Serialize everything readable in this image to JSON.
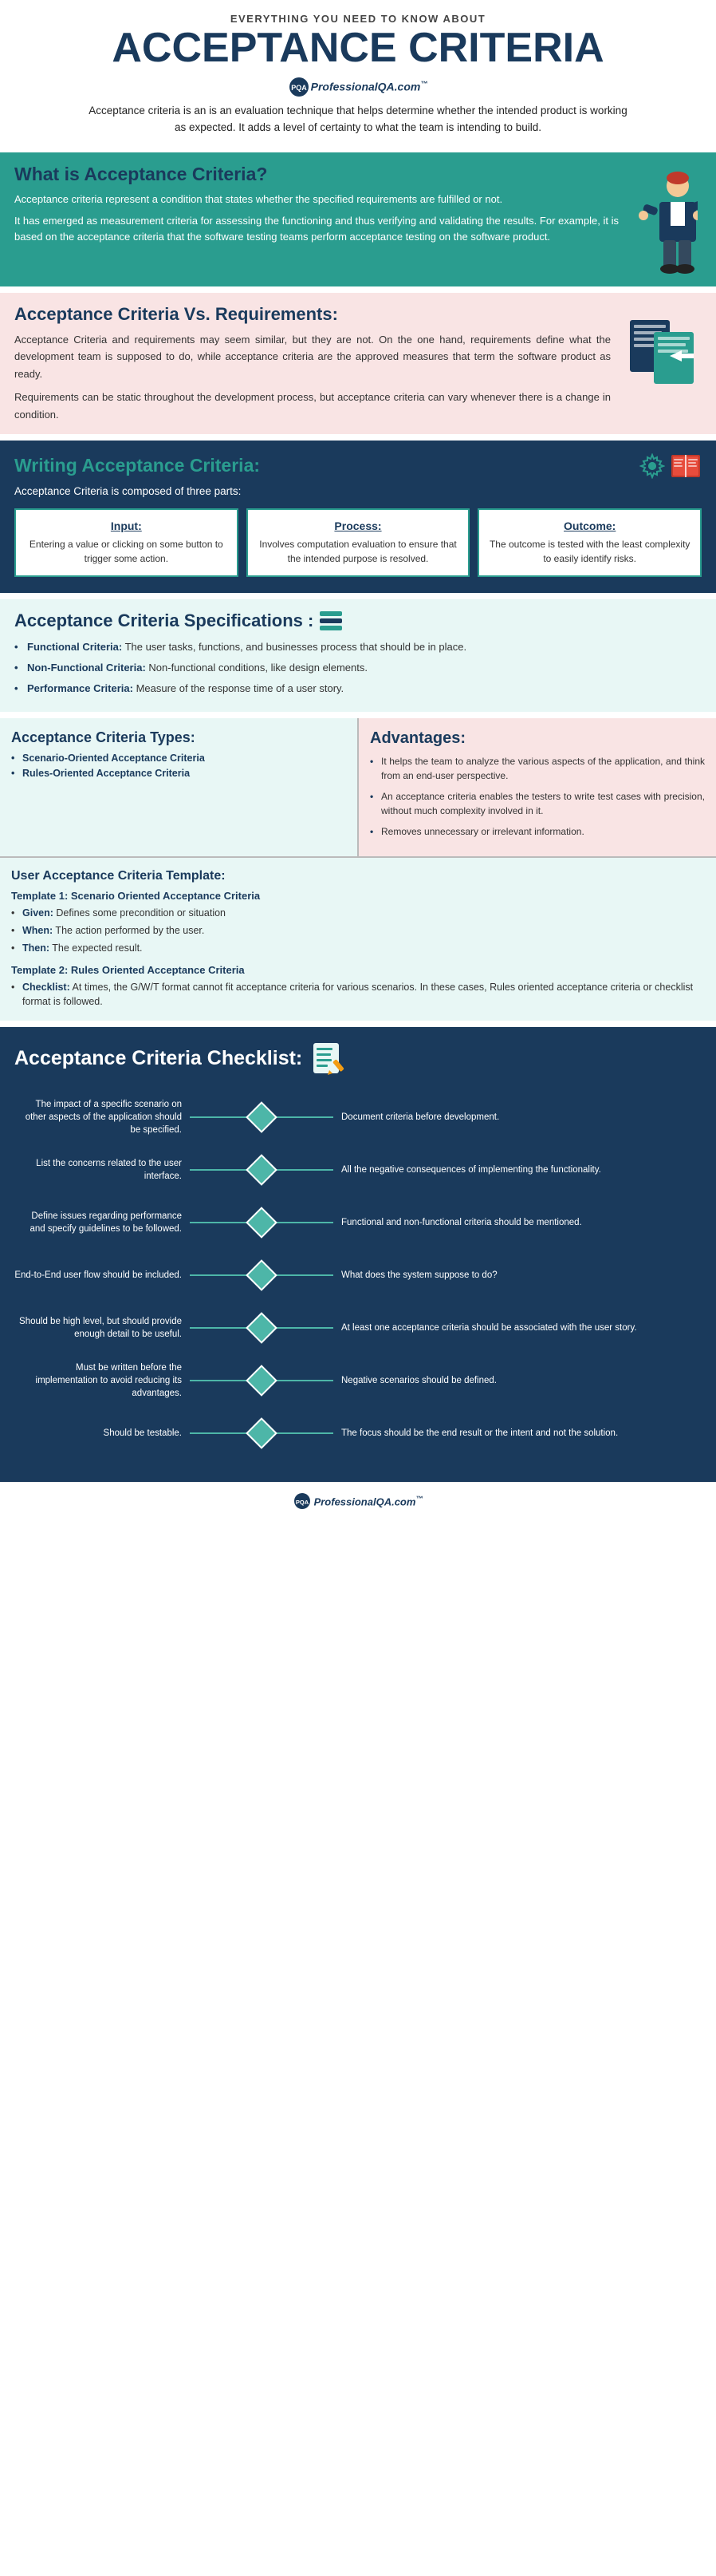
{
  "header": {
    "subtitle": "EVERYTHING YOU NEED TO KNOW ABOUT",
    "title": "ACCEPTANCE CRITERIA",
    "brand": "ProfessionalQA.com",
    "brand_tm": "™",
    "description": "Acceptance criteria is an  is an evaluation technique that helps determine whether the intended product is working as expected. It adds a level of certainty to what the team is intending to build."
  },
  "what_section": {
    "heading": "What is Acceptance Criteria?",
    "text1": "Acceptance criteria represent a condition that states whether the specified requirements are fulfilled or not.",
    "text2": "It has emerged as measurement criteria for assessing the functioning and thus verifying and validating the results. For example, it is based on the acceptance criteria that the software testing teams perform acceptance testing on the software product."
  },
  "vs_section": {
    "heading": "Acceptance Criteria Vs. Requirements:",
    "text1": "Acceptance Criteria and requirements may seem similar, but they are not. On the one hand, requirements define what the development team is supposed to do, while acceptance criteria are the approved measures that term the software product as ready.",
    "text2": "Requirements can be static throughout the development process, but acceptance criteria can vary whenever there is a change in condition."
  },
  "writing_section": {
    "heading": "Writing Acceptance Criteria:",
    "subtext": "Acceptance Criteria is composed of three parts:",
    "cols": [
      {
        "title": "Input:",
        "text": "Entering a value or clicking on some button to trigger some action."
      },
      {
        "title": "Process:",
        "text": "Involves computation evaluation to ensure that the intended purpose is resolved."
      },
      {
        "title": "Outcome:",
        "text": "The outcome is tested with the least complexity to easily identify risks."
      }
    ]
  },
  "specs_section": {
    "heading": "Acceptance Criteria Specifications :",
    "items": [
      {
        "bold": "Functional Criteria:",
        "text": " The user tasks, functions, and businesses process that should be in place."
      },
      {
        "bold": "Non-Functional Criteria:",
        "text": " Non-functional conditions, like design elements."
      },
      {
        "bold": "Performance Criteria:",
        "text": " Measure of the response time of a user story."
      }
    ]
  },
  "types_section": {
    "heading": "Acceptance Criteria Types:",
    "items": [
      "Scenario-Oriented Acceptance Criteria",
      "Rules-Oriented Acceptance Criteria"
    ]
  },
  "advantages_section": {
    "heading": "Advantages:",
    "items": [
      "It helps the team to analyze the various aspects of the application, and think from an end-user perspective.",
      "An acceptance criteria enables the testers to write test cases with precision, without much complexity involved in it.",
      "Removes unnecessary or irrelevant information."
    ]
  },
  "template_section": {
    "heading": "User Acceptance Criteria Template:",
    "t1_title": "Template 1: Scenario Oriented Acceptance Criteria",
    "t1_items": [
      {
        "bold": "Given:",
        "text": " Defines some precondition or situation"
      },
      {
        "bold": "When:",
        "text": " The action performed by the user."
      },
      {
        "bold": "Then:",
        "text": " The expected result."
      }
    ],
    "t2_title": "Template 2: Rules Oriented Acceptance Criteria",
    "t2_bold": "Checklist:",
    "t2_text": " At times, the G/W/T format cannot fit acceptance criteria for various scenarios. In these cases, Rules oriented acceptance criteria or checklist format is followed."
  },
  "checklist_section": {
    "heading": "Acceptance Criteria Checklist:",
    "left_items": [
      "The impact of a specific scenario on other aspects of the application should be specified.",
      "List the concerns related to the user interface.",
      "Define issues regarding performance and specify guidelines to be followed.",
      "End-to-End user flow should be included.",
      "Should be high level, but should provide enough detail to be useful.",
      "Must be written before the implementation to avoid reducing its advantages.",
      "Should be testable."
    ],
    "right_items": [
      "Document criteria before development.",
      "All the negative consequences of implementing the functionality.",
      "Functional and non-functional criteria should be mentioned.",
      "What does the system suppose to do?",
      "At least one acceptance criteria should be associated with the user story.",
      "Negative scenarios should be defined.",
      "The focus should be the end result or the intent and not the solution."
    ]
  },
  "footer": {
    "brand": "ProfessionalQA.com",
    "tm": "™"
  }
}
